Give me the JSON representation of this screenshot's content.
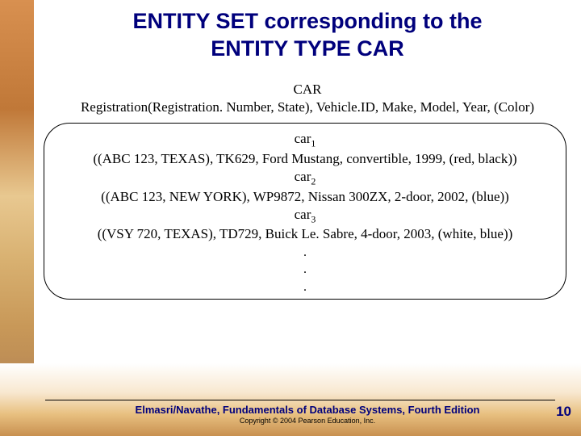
{
  "title_line1": "ENTITY SET corresponding to the",
  "title_line2": "ENTITY TYPE CAR",
  "schema": {
    "name": "CAR",
    "definition": "Registration(Registration. Number, State), Vehicle.ID, Make, Model, Year, (Color)"
  },
  "entities": [
    {
      "label": "car",
      "sub": "1",
      "tuple": "((ABC 123, TEXAS), TK629, Ford Mustang, convertible, 1999, (red, black))"
    },
    {
      "label": "car",
      "sub": "2",
      "tuple": "((ABC 123, NEW YORK), WP9872, Nissan 300ZX, 2-door, 2002, (blue))"
    },
    {
      "label": "car",
      "sub": "3",
      "tuple": "((VSY 720, TEXAS), TD729, Buick Le. Sabre, 4-door, 2003, (white, blue))"
    }
  ],
  "dots": [
    ".",
    ".",
    "."
  ],
  "footer": {
    "main": "Elmasri/Navathe, Fundamentals of Database Systems, Fourth Edition",
    "sub": "Copyright © 2004 Pearson Education, Inc."
  },
  "page_number": "10"
}
